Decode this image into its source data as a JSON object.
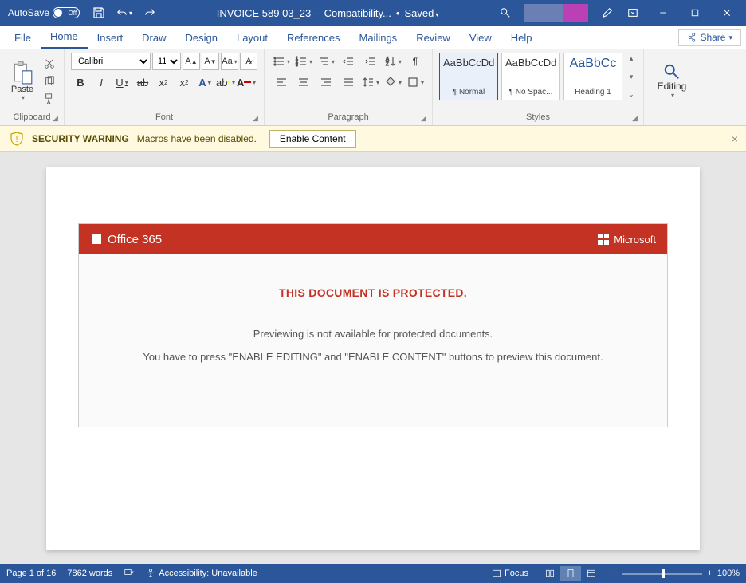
{
  "titlebar": {
    "autosave_label": "AutoSave",
    "autosave_state": "Off",
    "doc_title": "INVOICE 589 03_23",
    "compat": "Compatibility...",
    "saved": "Saved"
  },
  "tabs": {
    "file": "File",
    "home": "Home",
    "insert": "Insert",
    "draw": "Draw",
    "design": "Design",
    "layout": "Layout",
    "references": "References",
    "mailings": "Mailings",
    "review": "Review",
    "view": "View",
    "help": "Help",
    "share": "Share"
  },
  "ribbon": {
    "clipboard_label": "Clipboard",
    "paste_label": "Paste",
    "font_label": "Font",
    "font_name": "Calibri",
    "font_size": "11",
    "para_label": "Paragraph",
    "styles_label": "Styles",
    "style_preview_normal": "AaBbCcDd",
    "style_name_normal": "¶ Normal",
    "style_preview_nospace": "AaBbCcDd",
    "style_name_nospace": "¶ No Spac...",
    "style_preview_h1": "AaBbCc",
    "style_name_h1": "Heading 1",
    "editing_label": "Editing"
  },
  "securitybar": {
    "title": "SECURITY WARNING",
    "message": "Macros have been disabled.",
    "button": "Enable Content"
  },
  "lure": {
    "brand_left": "Office 365",
    "brand_right": "Microsoft",
    "protected": "THIS DOCUMENT IS PROTECTED.",
    "line1": "Previewing is not available for protected documents.",
    "line2": "You have to press \"ENABLE EDITING\" and \"ENABLE CONTENT\" buttons to preview this document."
  },
  "statusbar": {
    "page": "Page 1 of 16",
    "words": "7862 words",
    "accessibility": "Accessibility: Unavailable",
    "focus": "Focus",
    "zoom": "100%"
  }
}
